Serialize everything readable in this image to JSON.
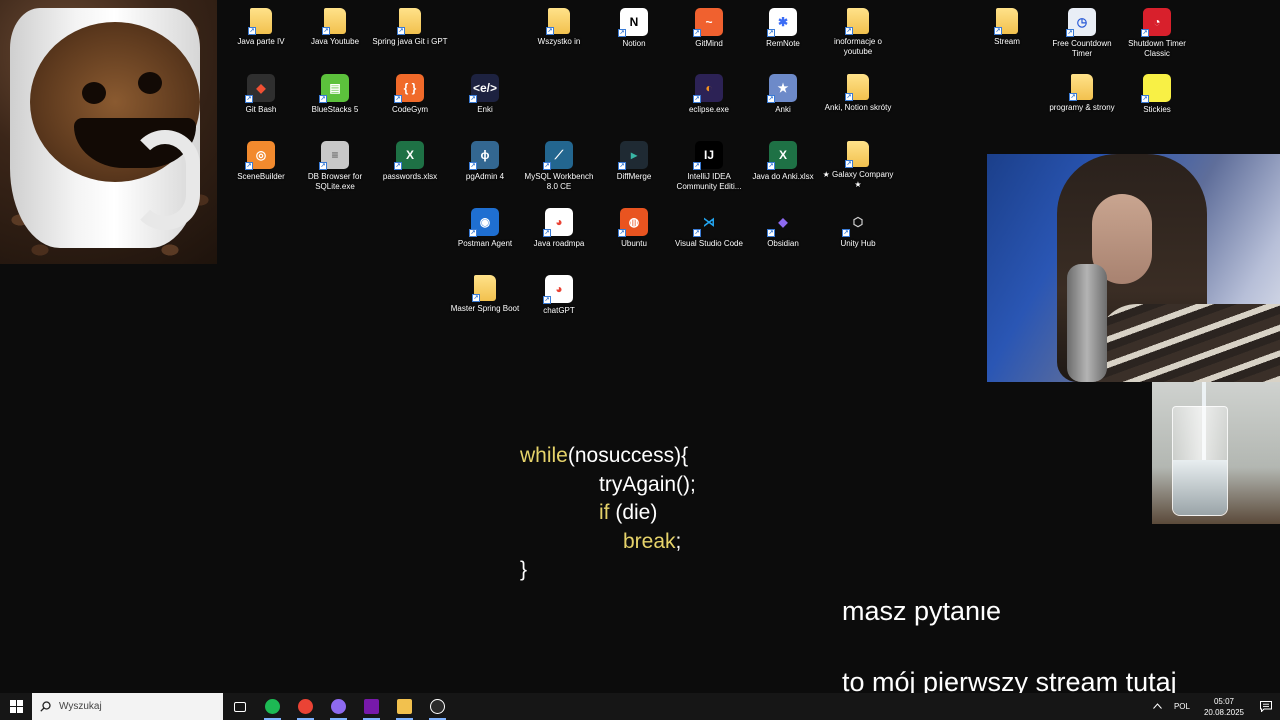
{
  "desktop": {
    "icons": [
      {
        "label": "Java parte IV",
        "type": "folder"
      },
      {
        "label": "Java Youtube",
        "type": "folder"
      },
      {
        "label": "Spring java Git i GPT",
        "type": "folder"
      },
      {
        "label": "Wszystko in",
        "type": "folder"
      },
      {
        "label": "Notion",
        "type": "app",
        "glyph": "N",
        "color": "#ffffff",
        "fg": "#000000"
      },
      {
        "label": "GitMind",
        "type": "app",
        "glyph": "~",
        "color": "#f0612f",
        "fg": "#ffffff"
      },
      {
        "label": "RemNote",
        "type": "app",
        "glyph": "✱",
        "color": "#ffffff",
        "fg": "#3b6cf5"
      },
      {
        "label": "inoformacje o youtube",
        "type": "folder"
      },
      {
        "label": "Stream",
        "type": "folder"
      },
      {
        "label": "Free Countdown Timer",
        "type": "app",
        "glyph": "◷",
        "color": "#e9eef6",
        "fg": "#2a5bd7"
      },
      {
        "label": "Shutdown Timer Classic",
        "type": "app",
        "glyph": "◔",
        "color": "#d8202c",
        "fg": "#ffffff"
      },
      {
        "label": "Git Bash",
        "type": "app",
        "glyph": "◆",
        "color": "#2f2f2f",
        "fg": "#f05033"
      },
      {
        "label": "BlueStacks 5",
        "type": "app",
        "glyph": "▤",
        "color": "#5cc13c",
        "fg": "#ffffff"
      },
      {
        "label": "CodeGym",
        "type": "app",
        "glyph": "{ }",
        "color": "#f06a2a",
        "fg": "#ffffff"
      },
      {
        "label": "Enki",
        "type": "app",
        "glyph": "<e/>",
        "color": "#1d2240",
        "fg": "#ffffff"
      },
      {
        "label": "eclipse.exe",
        "type": "app",
        "glyph": "◐",
        "color": "#2c2255",
        "fg": "#f7941e"
      },
      {
        "label": "Anki",
        "type": "app",
        "glyph": "★",
        "color": "#6d8ac9",
        "fg": "#ffffff"
      },
      {
        "label": "Anki, Notion skróty",
        "type": "folder"
      },
      {
        "label": "programy & strony",
        "type": "folder"
      },
      {
        "label": "Stickies",
        "type": "app",
        "glyph": "",
        "color": "#f8f045",
        "fg": "#000000"
      },
      {
        "label": "SceneBuilder",
        "type": "app",
        "glyph": "◎",
        "color": "#f28a2e",
        "fg": "#ffffff"
      },
      {
        "label": "DB Browser for SQLite.exe",
        "type": "app",
        "glyph": "≡",
        "color": "#c8c8c8",
        "fg": "#555555"
      },
      {
        "label": "passwords.xlsx",
        "type": "app",
        "glyph": "X",
        "color": "#1e7145",
        "fg": "#ffffff"
      },
      {
        "label": "pgAdmin 4",
        "type": "app",
        "glyph": "ϕ",
        "color": "#336791",
        "fg": "#ffffff"
      },
      {
        "label": "MySQL Workbench 8.0 CE",
        "type": "app",
        "glyph": "⟋",
        "color": "#23668f",
        "fg": "#ffffff"
      },
      {
        "label": "DiffMerge",
        "type": "app",
        "glyph": "▸",
        "color": "#1f2a33",
        "fg": "#39b5a4"
      },
      {
        "label": "IntelliJ IDEA Community Editi...",
        "type": "app",
        "glyph": "IJ",
        "color": "#000000",
        "fg": "#ffffff"
      },
      {
        "label": "Java do Anki.xlsx",
        "type": "app",
        "glyph": "X",
        "color": "#1e7145",
        "fg": "#ffffff"
      },
      {
        "label": "★ Galaxy Company ★",
        "type": "folder"
      },
      {
        "label": "Postman Agent",
        "type": "app",
        "glyph": "◉",
        "color": "#1f6fd1",
        "fg": "#ffffff"
      },
      {
        "label": "Java roadmpa",
        "type": "app",
        "glyph": "◕",
        "color": "#ffffff",
        "fg": "#ea4335"
      },
      {
        "label": "Ubuntu",
        "type": "app",
        "glyph": "◍",
        "color": "#e95420",
        "fg": "#ffffff"
      },
      {
        "label": "Visual Studio Code",
        "type": "app",
        "glyph": "⋊",
        "color": "#0c0c0c",
        "fg": "#23a6f2"
      },
      {
        "label": "Obsidian",
        "type": "app",
        "glyph": "◆",
        "color": "#0c0c0c",
        "fg": "#8e6af0"
      },
      {
        "label": "Unity Hub",
        "type": "app",
        "glyph": "⬡",
        "color": "#0c0c0c",
        "fg": "#cfcfcf"
      },
      {
        "label": "Master Spring Boot",
        "type": "folder"
      },
      {
        "label": "chatGPT",
        "type": "app",
        "glyph": "◕",
        "color": "#ffffff",
        "fg": "#ea4335"
      }
    ]
  },
  "code": {
    "line1_kw": "while",
    "line1_rest": "(nosuccess){",
    "line2": "tryAgain();",
    "line3_kw": "if",
    "line3_rest": " (die)",
    "line4_kw": "break",
    "line4_rest": ";",
    "line5": "}"
  },
  "captions": {
    "line1": "masz pytanie",
    "line2": "to mój pierwszy stream tutaj"
  },
  "taskbar": {
    "search_placeholder": "Wyszukaj",
    "apps": [
      {
        "name": "task-view",
        "color": "#ffffff"
      },
      {
        "name": "spotify",
        "color": "#1db954"
      },
      {
        "name": "chrome",
        "color": "#ea4335"
      },
      {
        "name": "obsidian",
        "color": "#8e6af0"
      },
      {
        "name": "onenote",
        "color": "#7719aa"
      },
      {
        "name": "file-explorer",
        "color": "#f2c14e"
      },
      {
        "name": "obs-studio",
        "color": "#2b2b2b"
      }
    ],
    "language": "POL",
    "time": "05:07",
    "date": "20.08.2025"
  },
  "colors": {
    "background": "#0c0c0c",
    "code_keyword": "#e6d36a",
    "taskbar": "#161616"
  }
}
